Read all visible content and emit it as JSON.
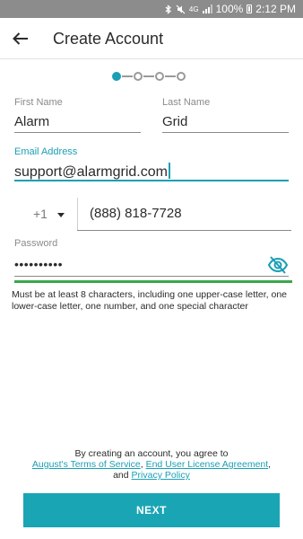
{
  "status_bar": {
    "bluetooth_icon": "bluetooth-icon",
    "mute_icon": "mute-icon",
    "network": "4G",
    "signal_icon": "signal-icon",
    "battery_percent": "100%",
    "battery_icon": "battery-icon",
    "time": "2:12 PM"
  },
  "header": {
    "back_icon": "back-arrow-icon",
    "title": "Create Account"
  },
  "stepper": {
    "total_steps": 4,
    "current_step": 1
  },
  "form": {
    "first_name": {
      "label": "First Name",
      "value": "Alarm"
    },
    "last_name": {
      "label": "Last Name",
      "value": "Grid"
    },
    "email": {
      "label": "Email Address",
      "value": "support@alarmgrid.com"
    },
    "phone": {
      "country_code": "+1",
      "number": "(888) 818-7728"
    },
    "password": {
      "label": "Password",
      "value": "••••••••••",
      "visibility_icon": "eye-off-icon",
      "strength": "strong"
    },
    "password_hint": "Must be at least 8 characters, including one upper-case letter, one lower-case letter, one number, and one special character"
  },
  "legal": {
    "line1": "By creating an account, you agree to",
    "terms_link": "August's Terms of Service",
    "comma1": ",",
    "eula_link": "End User License Agreement",
    "comma2": ",",
    "and_text": "and",
    "privacy_link": "Privacy Policy"
  },
  "actions": {
    "next_label": "NEXT"
  },
  "colors": {
    "accent": "#1a9fb5",
    "strength_bar": "#39a84a",
    "status_bar": "#8c8c8c"
  }
}
